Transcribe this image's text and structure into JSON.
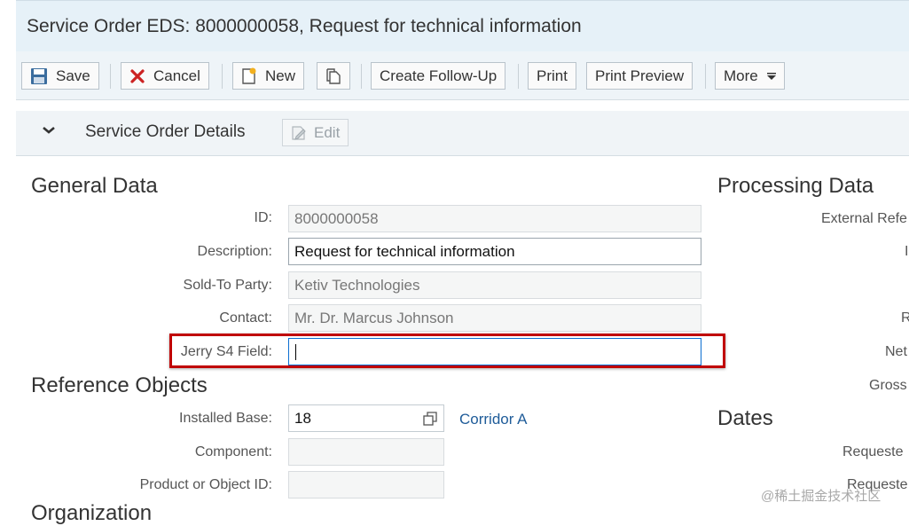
{
  "window": {
    "title": "Service Order EDS: 8000000058, Request for technical information"
  },
  "toolbar": {
    "save": "Save",
    "cancel": "Cancel",
    "new": "New",
    "create_follow_up": "Create Follow-Up",
    "print": "Print",
    "print_preview": "Print Preview",
    "more": "More"
  },
  "details": {
    "label": "Service Order Details",
    "edit": "Edit"
  },
  "general_data": {
    "title": "General Data",
    "id_label": "ID:",
    "id_value": "8000000058",
    "description_label": "Description:",
    "description_value": "Request for technical information",
    "sold_to_label": "Sold-To Party:",
    "sold_to_value": "Ketiv Technologies",
    "contact_label": "Contact:",
    "contact_value": "Mr. Dr. Marcus Johnson",
    "custom_label": "Jerry S4 Field:",
    "custom_value": ""
  },
  "reference_objects": {
    "title": "Reference Objects",
    "installed_base_label": "Installed Base:",
    "installed_base_value": "18",
    "installed_base_link": "Corridor A",
    "component_label": "Component:",
    "component_value": "",
    "product_label": "Product or Object ID:",
    "product_value": ""
  },
  "processing_data": {
    "title": "Processing Data",
    "external_ref_label": "External Refe",
    "r1": "I",
    "r2": "R",
    "net_label": "Net",
    "gross_label": "Gross"
  },
  "dates": {
    "title": "Dates",
    "requested1": "Requeste",
    "requested2": "Requeste"
  },
  "organization": {
    "title": "Organization"
  },
  "watermark": "@稀土掘金技术社区",
  "colors": {
    "accent": "#0a6ed1",
    "highlight": "#c00000",
    "link": "#1f5c99",
    "save_icon": "#3b6d9e",
    "cancel_icon": "#cc2222"
  }
}
